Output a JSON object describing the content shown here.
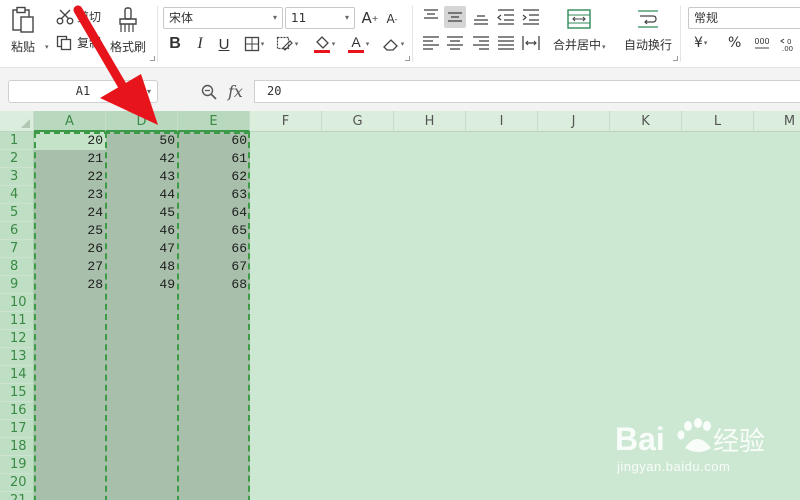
{
  "ribbon": {
    "paste_label": "粘贴",
    "cut_label": "剪切",
    "copy_label": "复制",
    "format_painter_label": "格式刷",
    "font_name": "宋体",
    "font_size": "11",
    "bold": "B",
    "italic": "I",
    "underline": "U",
    "merge_center_label": "合并居中",
    "wrap_text_label": "自动换行",
    "number_format": "常规",
    "currency_symbol": "¥",
    "percent_symbol": "%"
  },
  "formula_bar": {
    "name_box": "A1",
    "fx_label": "fx",
    "value": "20"
  },
  "grid": {
    "columns": [
      "A",
      "D",
      "E",
      "F",
      "G",
      "H",
      "I",
      "J",
      "K",
      "L",
      "M"
    ],
    "rows": [
      "1",
      "2",
      "3",
      "4",
      "5",
      "6",
      "7",
      "8",
      "9",
      "10",
      "11",
      "12",
      "13",
      "14",
      "15",
      "16",
      "17",
      "18",
      "19",
      "20",
      "21"
    ],
    "col_a": [
      "20",
      "21",
      "22",
      "23",
      "24",
      "25",
      "26",
      "27",
      "28"
    ],
    "col_d": [
      "50",
      "42",
      "43",
      "44",
      "45",
      "46",
      "47",
      "48",
      "49"
    ],
    "col_e": [
      "60",
      "61",
      "62",
      "63",
      "64",
      "65",
      "66",
      "67",
      "68"
    ]
  },
  "watermark": {
    "brand": "Bai du",
    "brand_suffix": "经验",
    "url": "jingyan.baidu.com"
  },
  "colors": {
    "selection_green": "#3d9a45",
    "arrow_red": "#e8141b",
    "sheet_background": "#cde8d2"
  }
}
